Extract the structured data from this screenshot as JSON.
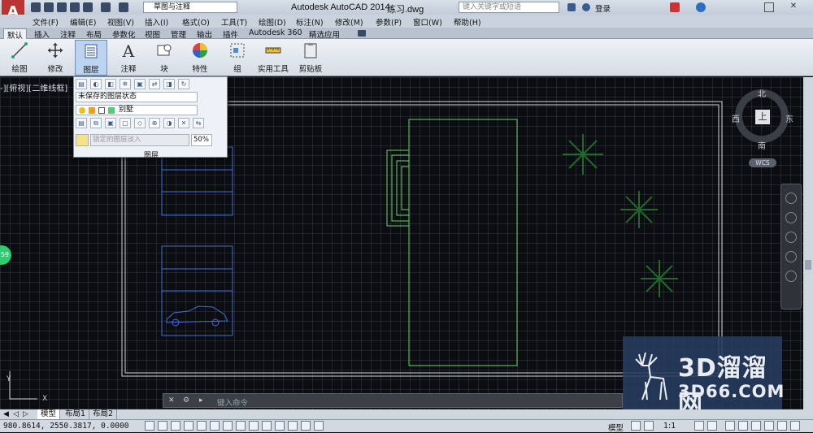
{
  "titlebar": {
    "workspace": "草图与注释",
    "app_title": "Autodesk AutoCAD 2014",
    "file_name": "练习.dwg",
    "search_placeholder": "键入关键字或短语",
    "login": "登录"
  },
  "menu": [
    "文件(F)",
    "编辑(E)",
    "视图(V)",
    "插入(I)",
    "格式(O)",
    "工具(T)",
    "绘图(D)",
    "标注(N)",
    "修改(M)",
    "参数(P)",
    "窗口(W)",
    "帮助(H)"
  ],
  "tabs": [
    "默认",
    "插入",
    "注释",
    "布局",
    "参数化",
    "视图",
    "管理",
    "输出",
    "插件",
    "Autodesk 360",
    "精选应用"
  ],
  "ribbon": [
    "绘图",
    "修改",
    "图层",
    "注释",
    "块",
    "特性",
    "组",
    "实用工具",
    "剪贴板"
  ],
  "viewport_label": "-][俯视][二维线框]",
  "layer_panel": {
    "state_dropdown": "未保存的图层状态",
    "current_layer": "别墅",
    "lock_fade_label": "锁定的图层淡入",
    "lock_fade_value": "50%",
    "caption": "图层"
  },
  "compass": {
    "north": "北",
    "south": "南",
    "east": "东",
    "west": "西",
    "center": "上",
    "wcs": "WCS"
  },
  "command_prompt": "键入命令",
  "layout_tabs": [
    "模型",
    "布局1",
    "布局2"
  ],
  "status": {
    "coords": "980.8614,  2550.3817, 0.0000",
    "model": "模型",
    "scale": "1:1"
  },
  "watermark": {
    "main": "3D溜溜网",
    "url": "3D66.COM"
  },
  "badge": "59",
  "colors": {
    "accent": "#3a8fd8",
    "drawing_green": "#6ed06e",
    "drawing_blue": "#3f6fe0"
  }
}
